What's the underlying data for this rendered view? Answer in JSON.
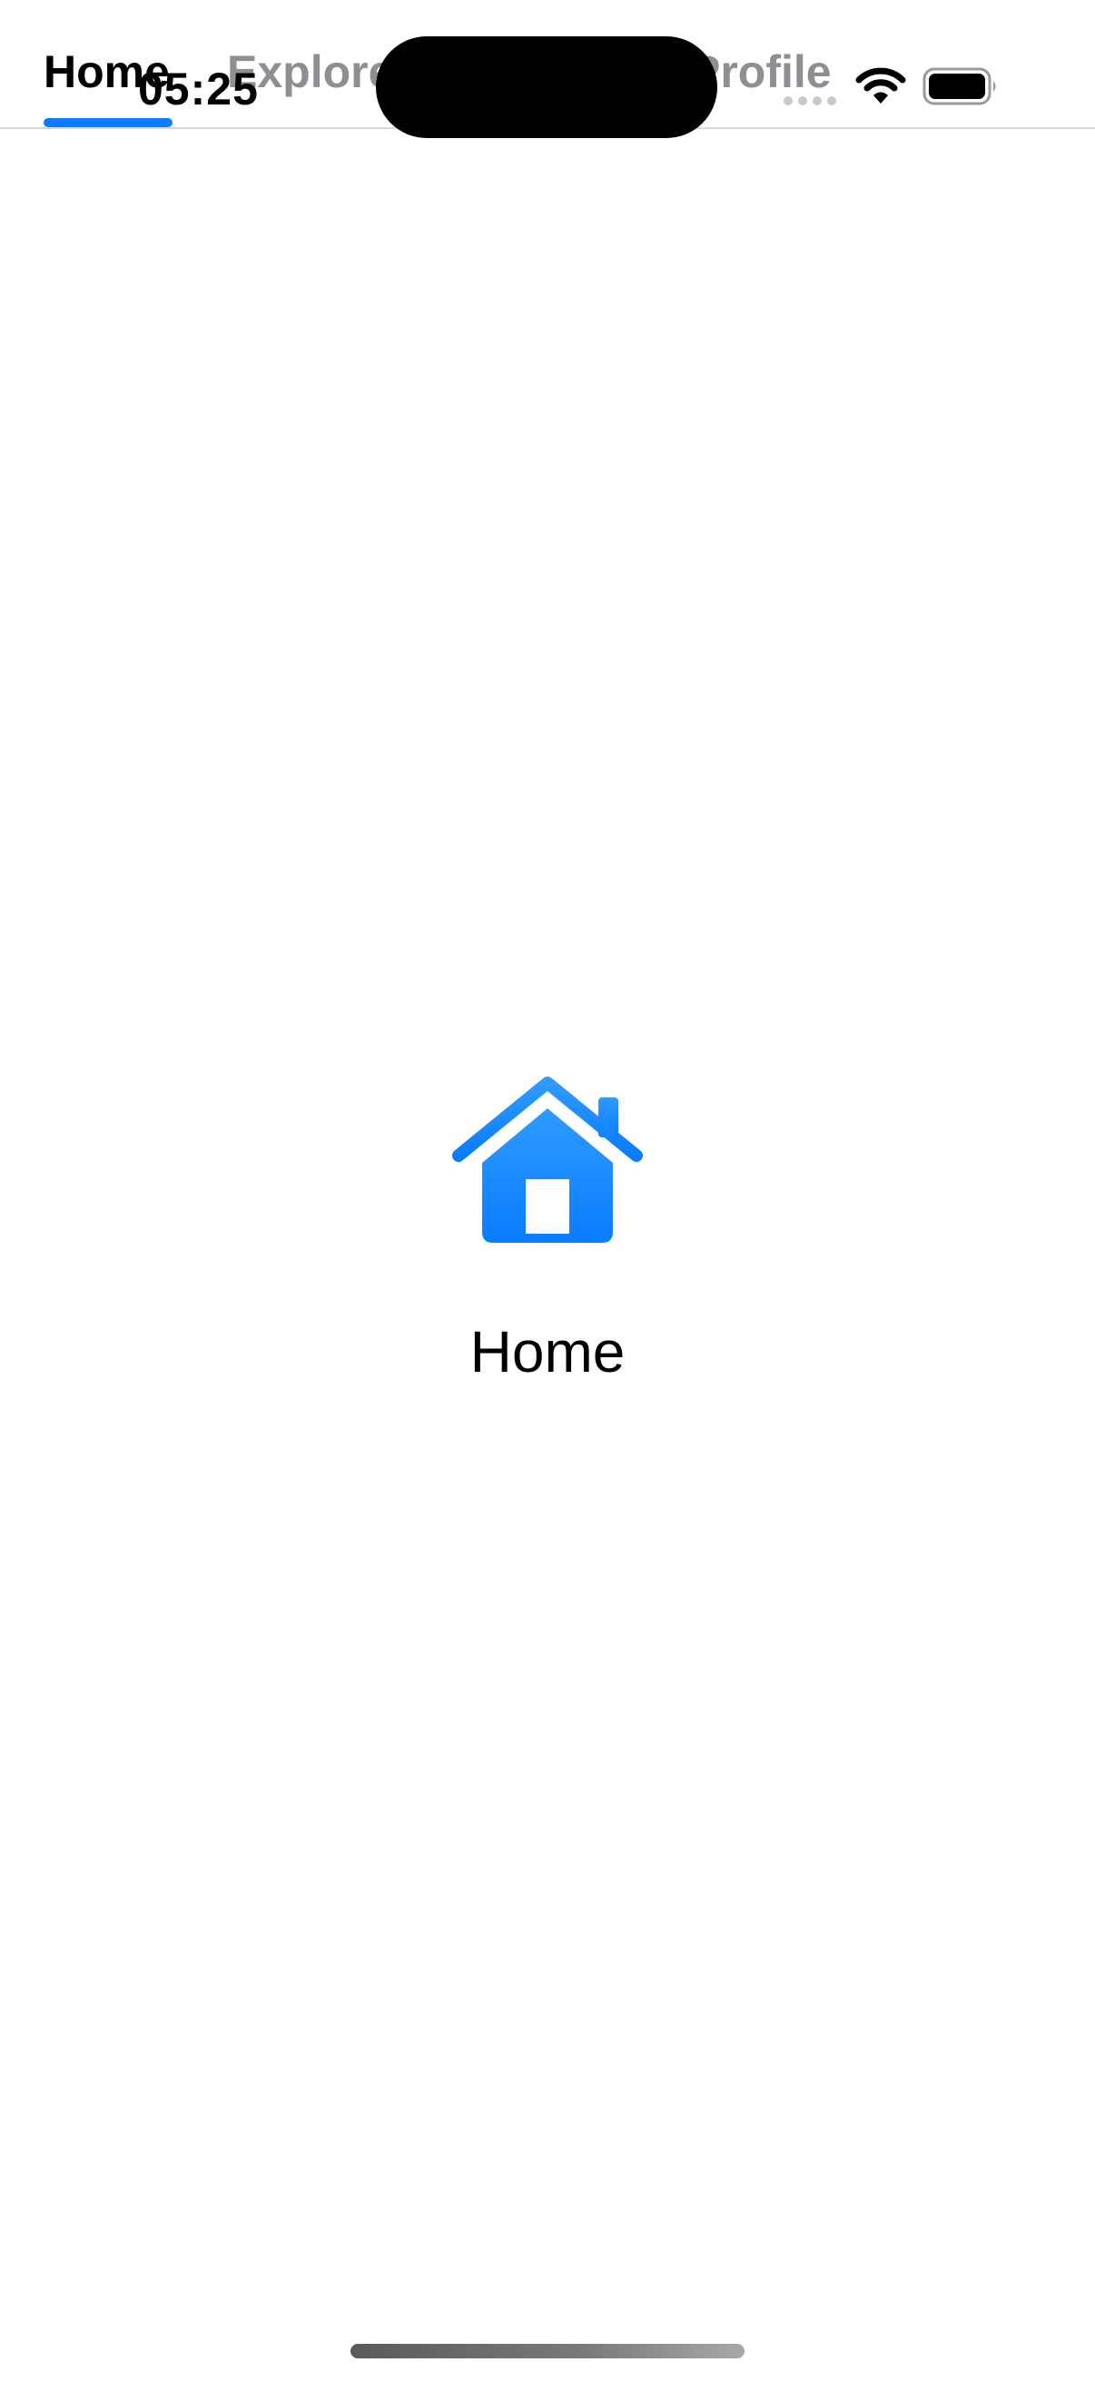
{
  "tabs": [
    {
      "label": "Home",
      "selected": true
    },
    {
      "label": "Explore",
      "selected": false
    },
    {
      "label": "Profile",
      "selected": false
    }
  ],
  "status_bar": {
    "time": "05:25",
    "icons": [
      "cellular-signal-icon",
      "wifi-icon",
      "battery-icon"
    ]
  },
  "content": {
    "icon": "house-fill-icon",
    "label": "Home"
  },
  "colors": {
    "accent": "#0a7cff",
    "accent_light": "#2f9bff",
    "tab_selected": "#000000",
    "tab_unselected": "#8e8e93"
  }
}
